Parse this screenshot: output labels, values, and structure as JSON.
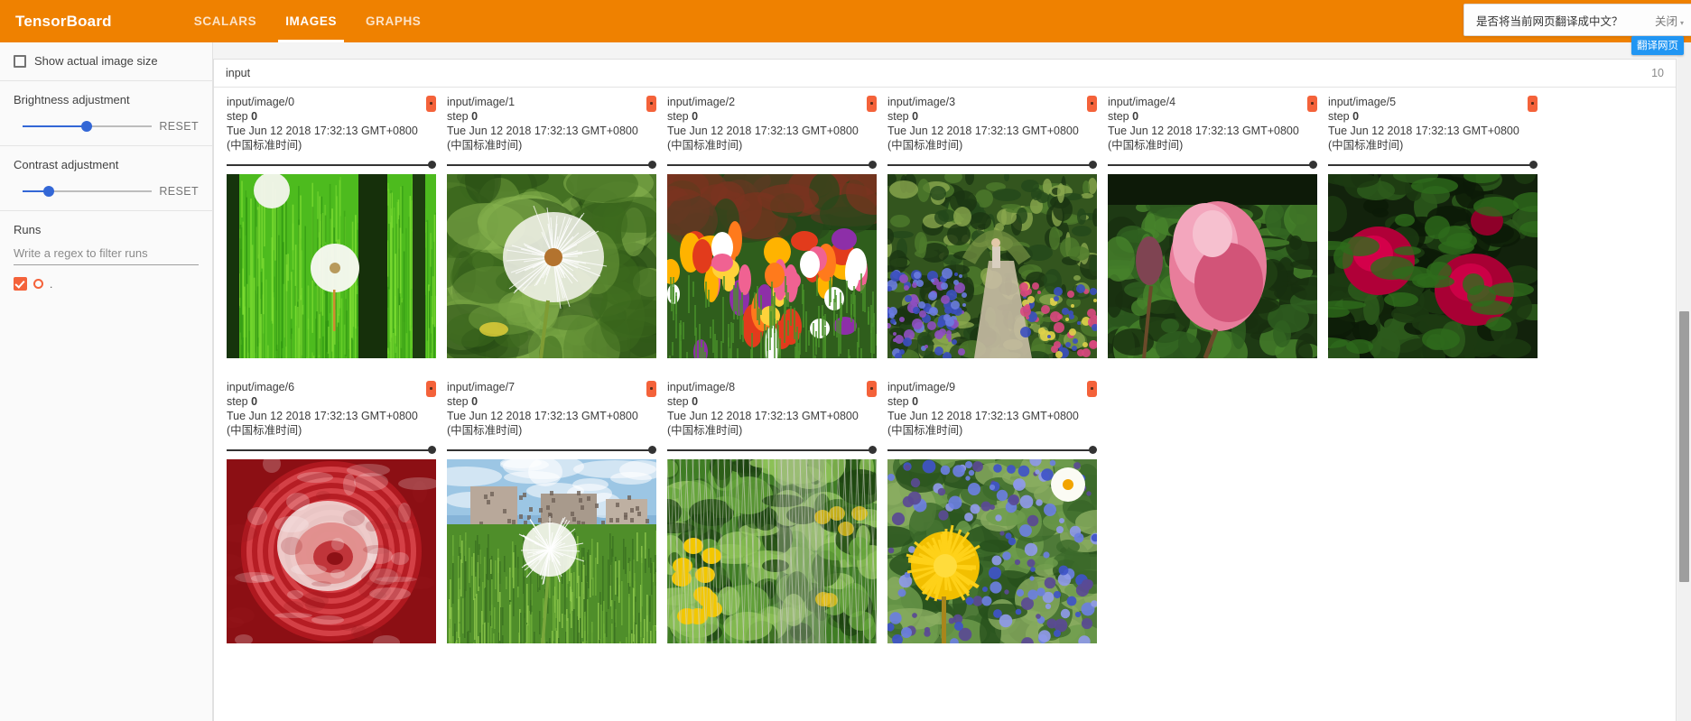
{
  "app": {
    "brand": "TensorBoard",
    "tabs": [
      {
        "label": "SCALARS",
        "active": false
      },
      {
        "label": "IMAGES",
        "active": true
      },
      {
        "label": "GRAPHS",
        "active": false
      }
    ]
  },
  "translate_bar": {
    "message": "是否将当前网页翻译成中文？",
    "close_label": "关闭",
    "chevron": "▾",
    "tooltip": "翻译网页"
  },
  "sidebar": {
    "show_actual_size_label": "Show actual image size",
    "brightness": {
      "label": "Brightness adjustment",
      "reset_label": "RESET",
      "percent": 52
    },
    "contrast": {
      "label": "Contrast adjustment",
      "reset_label": "RESET",
      "percent": 21
    },
    "runs": {
      "label": "Runs",
      "filter_placeholder": "Write a regex to filter runs",
      "filter_value": "",
      "items": [
        {
          "name": ".",
          "color": "#f4623a",
          "checked": true
        }
      ]
    }
  },
  "main": {
    "category": {
      "name": "input",
      "count": "10"
    },
    "cards": [
      {
        "title": "input/image/0",
        "step_label": "step",
        "step_value": "0",
        "time": "Tue Jun 12 2018 17:32:13 GMT+0800 (中国标准时间)",
        "alt": "dandelion seedheads in tall green grass"
      },
      {
        "title": "input/image/1",
        "step_label": "step",
        "step_value": "0",
        "time": "Tue Jun 12 2018 17:32:13 GMT+0800 (中国标准时间)",
        "alt": "close-up dandelion seedhead on blurred green background"
      },
      {
        "title": "input/image/2",
        "step_label": "step",
        "step_value": "0",
        "time": "Tue Jun 12 2018 17:32:13 GMT+0800 (中国标准时间)",
        "alt": "colourful tulip flower bed"
      },
      {
        "title": "input/image/3",
        "step_label": "step",
        "step_value": "0",
        "time": "Tue Jun 12 2018 17:32:13 GMT+0800 (中国标准时间)",
        "alt": "garden path with arch and blue flowers"
      },
      {
        "title": "input/image/4",
        "step_label": "step",
        "step_value": "0",
        "time": "Tue Jun 12 2018 17:32:13 GMT+0800 (中国标准时间)",
        "alt": "pink rose bloom with bud"
      },
      {
        "title": "input/image/5",
        "step_label": "step",
        "step_value": "0",
        "time": "Tue Jun 12 2018 17:32:13 GMT+0800 (中国标准时间)",
        "alt": "deep red roses on dark background"
      },
      {
        "title": "input/image/6",
        "step_label": "step",
        "step_value": "0",
        "time": "Tue Jun 12 2018 17:32:13 GMT+0800 (中国标准时间)",
        "alt": "red and white swirled rose close-up"
      },
      {
        "title": "input/image/7",
        "step_label": "step",
        "step_value": "0",
        "time": "Tue Jun 12 2018 17:32:13 GMT+0800 (中国标准时间)",
        "alt": "dandelion seedhead with buildings and sky"
      },
      {
        "title": "input/image/8",
        "step_label": "step",
        "step_value": "0",
        "time": "Tue Jun 12 2018 17:32:13 GMT+0800 (中国标准时间)",
        "alt": "yellow flowers behind a wire fence"
      },
      {
        "title": "input/image/9",
        "step_label": "step",
        "step_value": "0",
        "time": "Tue Jun 12 2018 17:32:13 GMT+0800 (中国标准时间)",
        "alt": "yellow dandelion among blue bugle flowers"
      }
    ]
  },
  "colors": {
    "brand_orange": "#ef8100",
    "run_orange": "#f4623a",
    "slider_blue": "#3367d6",
    "tooltip_blue": "#2196f3"
  }
}
